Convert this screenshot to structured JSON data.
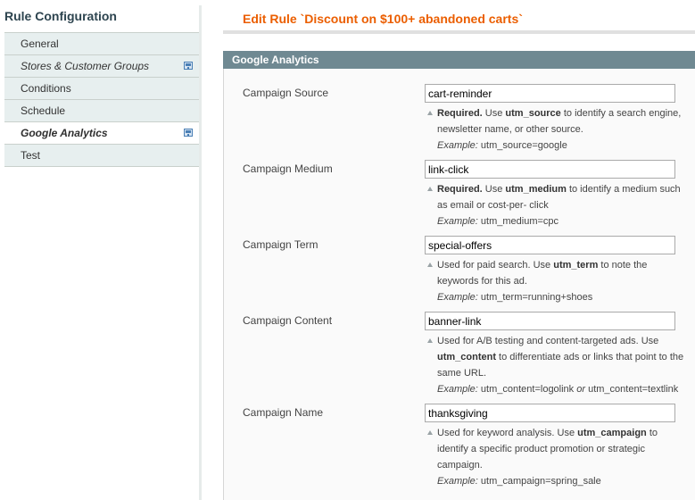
{
  "sidebar": {
    "title": "Rule Configuration",
    "tabs": [
      {
        "label": "General"
      },
      {
        "label": "Stores & Customer Groups"
      },
      {
        "label": "Conditions"
      },
      {
        "label": "Schedule"
      },
      {
        "label": "Google Analytics"
      },
      {
        "label": "Test"
      }
    ]
  },
  "page": {
    "title": "Edit Rule `Discount on $100+ abandoned carts`"
  },
  "fieldset": {
    "title": "Google Analytics"
  },
  "fields": {
    "source": {
      "label": "Campaign Source",
      "value": "cart-reminder",
      "req": "Required.",
      "pre": " Use ",
      "param": "utm_source",
      "post": " to identify a search engine, newsletter name, or other source.",
      "example_label": "Example:",
      "example": " utm_source=google"
    },
    "medium": {
      "label": "Campaign Medium",
      "value": "link-click",
      "req": "Required.",
      "pre": " Use ",
      "param": "utm_medium",
      "post": " to identify a medium such as email or cost-per- click",
      "example_label": "Example:",
      "example": " utm_medium=cpc"
    },
    "term": {
      "label": "Campaign Term",
      "value": "special-offers",
      "pre": "Used for paid search. Use ",
      "param": "utm_term",
      "post": " to note the keywords for this ad.",
      "example_label": "Example:",
      "example": " utm_term=running+shoes"
    },
    "content": {
      "label": "Campaign Content",
      "value": "banner-link",
      "pre": "Used for A/B testing and content-targeted ads. Use ",
      "param": "utm_content",
      "post": " to differentiate ads or links that point to the same URL.",
      "example_label": "Example:",
      "example_a": " utm_content=logolink ",
      "example_or": "or",
      "example_b": " utm_content=textlink"
    },
    "name": {
      "label": "Campaign Name",
      "value": "thanksgiving",
      "pre": "Used for keyword analysis. Use ",
      "param": "utm_campaign",
      "post": " to identify a specific product promotion or strategic campaign.",
      "example_label": "Example:",
      "example": " utm_campaign=spring_sale"
    }
  }
}
